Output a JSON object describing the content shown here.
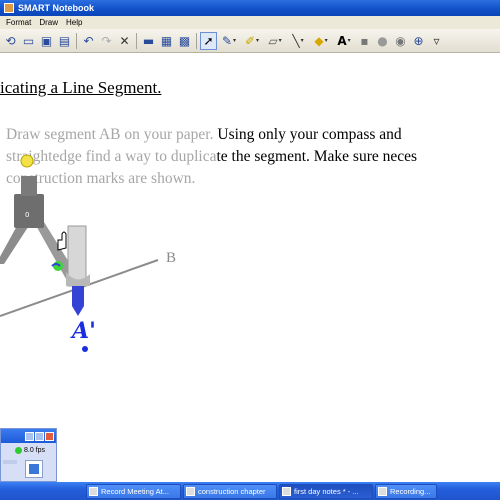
{
  "window": {
    "title": "SMART Notebook"
  },
  "menu": [
    "Format",
    "Draw",
    "Help"
  ],
  "toolbar": {
    "buttons": [
      {
        "name": "undo-icon",
        "glyph": "↶"
      },
      {
        "name": "redo-icon",
        "glyph": "↷"
      },
      {
        "name": "delete-icon",
        "glyph": "✕"
      },
      {
        "name": "select-icon",
        "glyph": "➚"
      },
      {
        "name": "pen-icon",
        "glyph": "✎"
      },
      {
        "name": "highlighter-icon",
        "glyph": "✐"
      },
      {
        "name": "eraser-icon",
        "glyph": "▱"
      },
      {
        "name": "line-icon",
        "glyph": "╲"
      },
      {
        "name": "fill-icon",
        "glyph": "◆"
      },
      {
        "name": "text-icon",
        "glyph": "A"
      }
    ]
  },
  "page": {
    "title": "icating a Line Segment.",
    "line1_gray": "Draw segment AB on your paper.",
    "line1_black": "  Using only your compass and",
    "line2_gray": "straightedge find a way to duplica",
    "line2_black": "te the segment.  Make sure neces",
    "line3_gray": "construction marks are shown.",
    "label_b": "B",
    "handwritten_label": "A'",
    "compass_badge": "0"
  },
  "recorder": {
    "fps": "8.0 fps"
  },
  "taskbar": {
    "items": [
      {
        "label": "Record Meeting At..."
      },
      {
        "label": "construction chapter"
      },
      {
        "label": "first day notes * - ..."
      },
      {
        "label": "Recording..."
      }
    ]
  },
  "colors": {
    "titlebar": "#1150c8",
    "ink_blue": "#1a2ee0",
    "compass_gray": "#8c8c8c"
  }
}
